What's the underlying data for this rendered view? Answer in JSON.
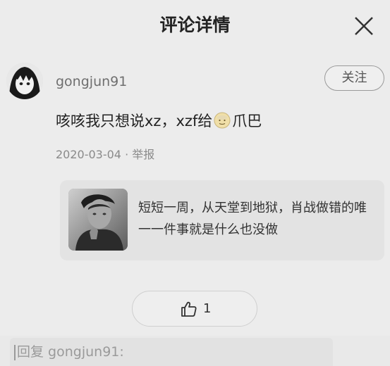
{
  "header": {
    "title": "评论详情",
    "close_icon": "close-icon"
  },
  "comment": {
    "username": "gongjun91",
    "follow_label": "关注",
    "text_before_emoji": "咳咳我只想说xz，xzf给",
    "emoji": "face-emoji",
    "text_after_emoji": "爪巴",
    "date": "2020-03-04",
    "separator": " · ",
    "report_label": "举报"
  },
  "quoted": {
    "text": "短短一周，从天堂到地狱，肖战做错的唯一一件事就是什么也没做"
  },
  "like": {
    "icon": "thumbs-up-icon",
    "count": "1"
  },
  "reply": {
    "placeholder": "回复 gongjun91:"
  },
  "colors": {
    "background": "#ececec",
    "card": "#e3e3e3",
    "muted": "#8a8a8a"
  }
}
